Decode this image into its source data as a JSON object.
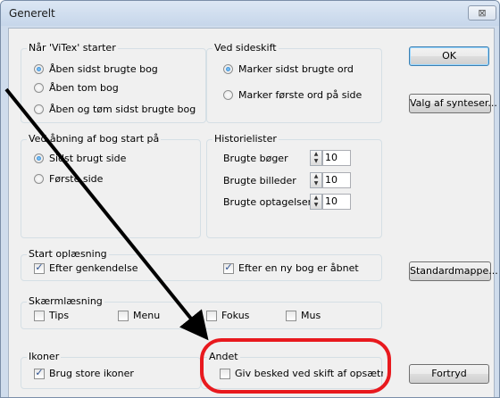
{
  "window": {
    "title": "Generelt",
    "close_glyph": "⊠"
  },
  "groups": {
    "start": {
      "label": "Når 'ViTex' starter",
      "options": [
        "Åben sidst brugte bog",
        "Åben tom bog",
        "Åben og tøm sidst brugte bog"
      ],
      "selected": 0
    },
    "pagebreak": {
      "label": "Ved sideskift",
      "options": [
        "Marker sidst brugte ord",
        "Marker første ord på side"
      ],
      "selected": 0
    },
    "open_book": {
      "label": "Ved åbning af bog start på",
      "options": [
        "Sidst brugt side",
        "Første side"
      ],
      "selected": 0
    },
    "history": {
      "label": "Historielister",
      "rows": [
        {
          "label": "Brugte bøger",
          "value": "10"
        },
        {
          "label": "Brugte billeder",
          "value": "10"
        },
        {
          "label": "Brugte optagelser",
          "value": "10"
        }
      ]
    },
    "reading": {
      "label": "Start oplæsning",
      "checks": [
        {
          "label": "Efter genkendelse",
          "checked": true
        },
        {
          "label": "Efter en ny bog er åbnet",
          "checked": true
        }
      ]
    },
    "screen": {
      "label": "Skærmlæsning",
      "checks": [
        {
          "label": "Tips",
          "checked": false
        },
        {
          "label": "Menu",
          "checked": false
        },
        {
          "label": "Fokus",
          "checked": false
        },
        {
          "label": "Mus",
          "checked": false
        }
      ]
    },
    "icons": {
      "label": "Ikoner",
      "checks": [
        {
          "label": "Brug store ikoner",
          "checked": true
        }
      ]
    },
    "other": {
      "label": "Andet",
      "checks": [
        {
          "label": "Giv besked ved skift af opsætning",
          "checked": false
        }
      ]
    }
  },
  "buttons": {
    "ok": "OK",
    "synth": "Valg af synteser...",
    "folders": "Standardmappe...",
    "cancel": "Fortryd"
  },
  "annotation": {
    "arrow_color": "#000000",
    "highlight_color": "#e8191e"
  },
  "colors": {
    "accent": "#1b6fc2",
    "titlebar": "#cfdcec"
  }
}
